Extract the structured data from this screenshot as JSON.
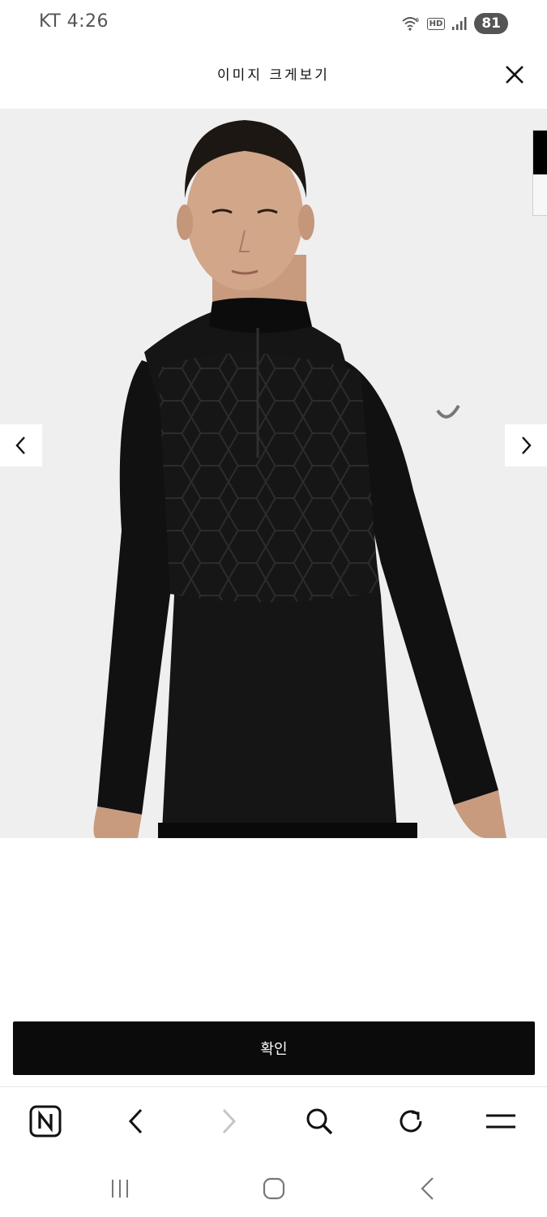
{
  "status_bar": {
    "time": "KT 4:26",
    "hd_label": "HD",
    "battery": "81",
    "icons": [
      "wifi-icon",
      "hd-icon",
      "signal-icon",
      "battery-icon"
    ]
  },
  "header": {
    "title": "이미지 크게보기",
    "close_icon": "close-icon"
  },
  "viewer": {
    "image_icon": "product-photo",
    "prev_icon": "chevron-left-icon",
    "next_icon": "chevron-right-icon"
  },
  "confirm": {
    "label": "확인"
  },
  "toolbar": {
    "items": [
      "naver-home-icon",
      "back-icon",
      "forward-icon",
      "search-icon",
      "refresh-icon",
      "menu-icon"
    ]
  },
  "system_nav": {
    "items": [
      "recent-apps-icon",
      "home-icon",
      "system-back-icon"
    ]
  },
  "colors": {
    "accent": "#0b0b0b",
    "background": "#efefef",
    "status_gray": "#555555"
  }
}
